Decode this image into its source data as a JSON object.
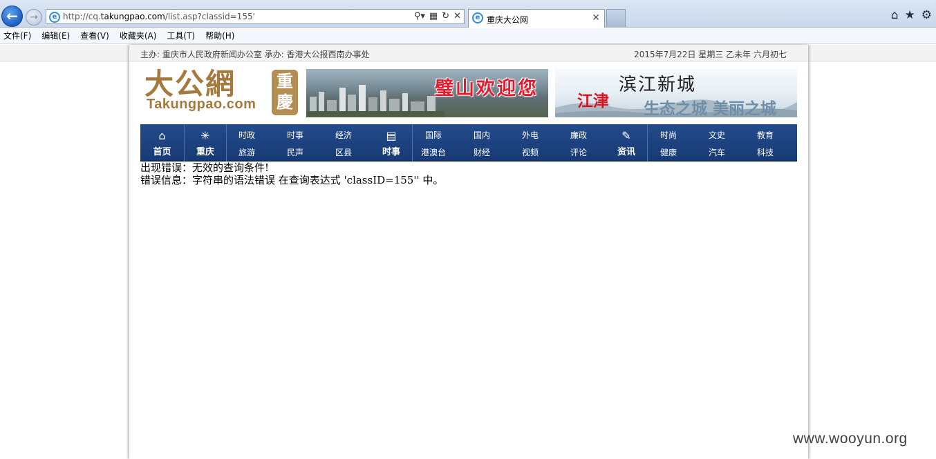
{
  "browser": {
    "address": {
      "prefix": "http://cq.",
      "host": "takungpao.com",
      "path": "/list.asp?classid=155'"
    },
    "tab": {
      "title": "重庆大公网"
    }
  },
  "menubar": {
    "items": [
      "文件(F)",
      "编辑(E)",
      "查看(V)",
      "收藏夹(A)",
      "工具(T)",
      "帮助(H)"
    ]
  },
  "header": {
    "host_text": "主办: 重庆市人民政府新闻办公室 承办: 香港大公报西南办事处",
    "date_text": "2015年7月22日 星期三 乙未年 六月初七"
  },
  "logo": {
    "cn": "大公網",
    "en": "Takungpao.com",
    "seal": "重慶"
  },
  "banners": {
    "b1": {
      "text": "璧山欢迎您"
    },
    "b2": {
      "red": "江津",
      "title": "滨江新城",
      "sub": "生态之城 美丽之城"
    }
  },
  "nav": {
    "home": "首页",
    "chongqing": "重庆",
    "shishi": "时事",
    "zixun": "资讯",
    "group1": {
      "row1": [
        "时政",
        "时事",
        "经济"
      ],
      "row2": [
        "旅游",
        "民声",
        "区县"
      ]
    },
    "group2": {
      "row1": [
        "国际",
        "国内",
        "外电",
        "廉政"
      ],
      "row2": [
        "港澳台",
        "财经",
        "视频",
        "评论"
      ]
    },
    "group3": {
      "row1": [
        "时尚",
        "文史",
        "教育"
      ],
      "row2": [
        "健康",
        "汽车",
        "科技"
      ]
    }
  },
  "error": {
    "line1": "出现错误：无效的查询条件!",
    "line2": "错误信息：字符串的语法错误 在查询表达式 'classID=155'' 中。"
  },
  "watermark": "www.wooyun.org"
}
